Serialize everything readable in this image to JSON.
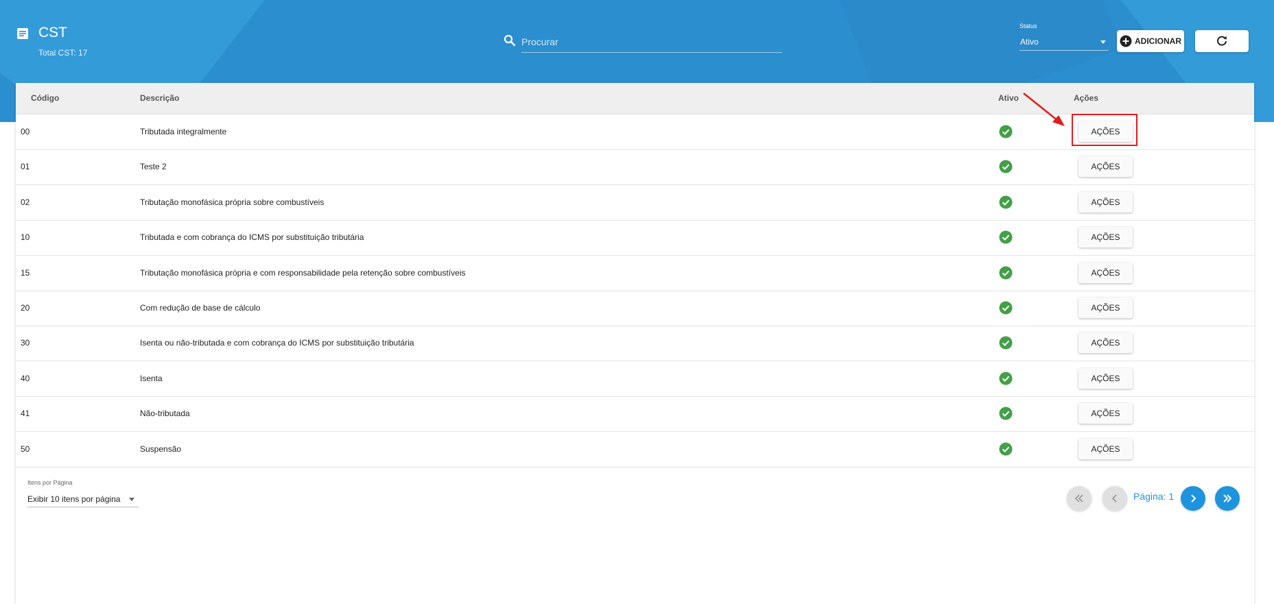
{
  "header": {
    "title": "CST",
    "total": "Total CST: 17",
    "search_placeholder": "Procurar",
    "status_label": "Status",
    "status_value": "Ativo",
    "add_label": "ADICIONAR",
    "colors": {
      "header_bg": "#2b8ecf",
      "accent": "#1e93de",
      "check": "#43a047",
      "highlight": "#e41b1b"
    }
  },
  "table": {
    "columns": [
      "Código",
      "Descrição",
      "Ativo",
      "Ações"
    ],
    "action_label": "AÇÕES",
    "rows": [
      {
        "code": "00",
        "desc": "Tributada integralmente",
        "active": true
      },
      {
        "code": "01",
        "desc": "Teste 2",
        "active": true
      },
      {
        "code": "02",
        "desc": "Tributação monofásica própria sobre combustíveis",
        "active": true
      },
      {
        "code": "10",
        "desc": "Tributada e com cobrança do ICMS por substituição tributária",
        "active": true
      },
      {
        "code": "15",
        "desc": "Tributação monofásica própria e com responsabilidade pela retenção sobre combustíveis",
        "active": true
      },
      {
        "code": "20",
        "desc": "Com redução de base de cálculo",
        "active": true
      },
      {
        "code": "30",
        "desc": "Isenta ou não-tributada e com cobrança do ICMS por substituição tributária",
        "active": true
      },
      {
        "code": "40",
        "desc": "Isenta",
        "active": true
      },
      {
        "code": "41",
        "desc": "Não-tributada",
        "active": true
      },
      {
        "code": "50",
        "desc": "Suspensão",
        "active": true
      }
    ]
  },
  "footer": {
    "items_per_page_label": "Itens por Página",
    "items_per_page_value": "Exibir 10 itens por página",
    "page_text": "Página: 1"
  }
}
